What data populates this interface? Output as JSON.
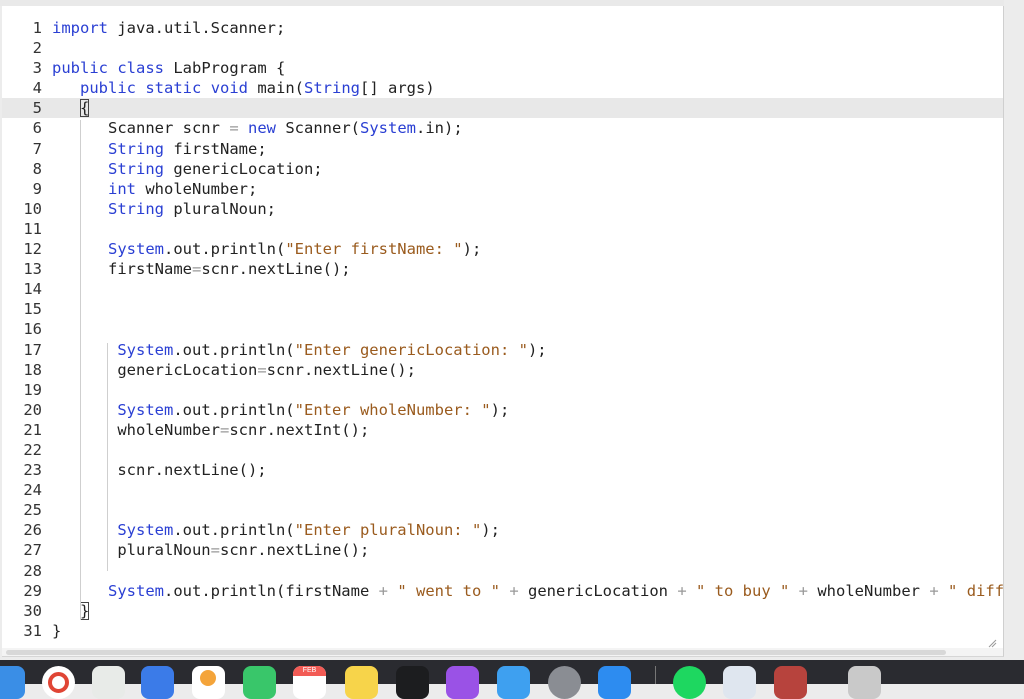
{
  "editor": {
    "lines": [
      {
        "n": "1",
        "html": "<span class='kw'>import</span> java.util.Scanner;"
      },
      {
        "n": "2",
        "html": ""
      },
      {
        "n": "3",
        "html": "<span class='kw'>public</span> <span class='kw'>class</span> LabProgram {"
      },
      {
        "n": "4",
        "html": "   <span class='kw'>public</span> <span class='kw'>static</span> <span class='kw'>void</span> main(<span class='ty'>String</span>[] args)"
      },
      {
        "n": "5",
        "html": "   <span class='bracket'>{</span>"
      },
      {
        "n": "6",
        "html": "      Scanner scnr <span class='op'>=</span> <span class='kw'>new</span> Scanner(<span class='ty'>System</span>.in);"
      },
      {
        "n": "7",
        "html": "      <span class='ty'>String</span> firstName;"
      },
      {
        "n": "8",
        "html": "      <span class='ty'>String</span> genericLocation;"
      },
      {
        "n": "9",
        "html": "      <span class='kw'>int</span> wholeNumber;"
      },
      {
        "n": "10",
        "html": "      <span class='ty'>String</span> pluralNoun;"
      },
      {
        "n": "11",
        "html": ""
      },
      {
        "n": "12",
        "html": "      <span class='ty'>System</span>.out.println(<span class='str'>\"Enter firstName: \"</span>);"
      },
      {
        "n": "13",
        "html": "      firstName<span class='op'>=</span>scnr.nextLine();"
      },
      {
        "n": "14",
        "html": ""
      },
      {
        "n": "15",
        "html": ""
      },
      {
        "n": "16",
        "html": ""
      },
      {
        "n": "17",
        "html": "       <span class='ty'>System</span>.out.println(<span class='str'>\"Enter genericLocation: \"</span>);"
      },
      {
        "n": "18",
        "html": "       genericLocation<span class='op'>=</span>scnr.nextLine();"
      },
      {
        "n": "19",
        "html": ""
      },
      {
        "n": "20",
        "html": "       <span class='ty'>System</span>.out.println(<span class='str'>\"Enter wholeNumber: \"</span>);"
      },
      {
        "n": "21",
        "html": "       wholeNumber<span class='op'>=</span>scnr.nextInt();"
      },
      {
        "n": "22",
        "html": ""
      },
      {
        "n": "23",
        "html": "       scnr.nextLine();"
      },
      {
        "n": "24",
        "html": ""
      },
      {
        "n": "25",
        "html": ""
      },
      {
        "n": "26",
        "html": "       <span class='ty'>System</span>.out.println(<span class='str'>\"Enter pluralNoun: \"</span>);"
      },
      {
        "n": "27",
        "html": "       pluralNoun<span class='op'>=</span>scnr.nextLine();"
      },
      {
        "n": "28",
        "html": ""
      },
      {
        "n": "29",
        "html": "      <span class='ty'>System</span>.out.println(firstName <span class='op'>+</span> <span class='str'>\" went to \"</span> <span class='op'>+</span> genericLocation <span class='op'>+</span> <span class='str'>\" to buy \"</span> <span class='op'>+</span> wholeNumber <span class='op'>+</span> <span class='str'>\" different</span>"
      },
      {
        "n": "30",
        "html": "   <span class='bracket'>}</span>"
      },
      {
        "n": "31",
        "html": "}"
      }
    ],
    "highlighted_line": "5"
  },
  "dock": {
    "calendar_month": "FEB"
  },
  "colors": {
    "keyword": "#2a3fd3",
    "string": "#9a5b1e",
    "highlight": "#e8e8e8"
  }
}
